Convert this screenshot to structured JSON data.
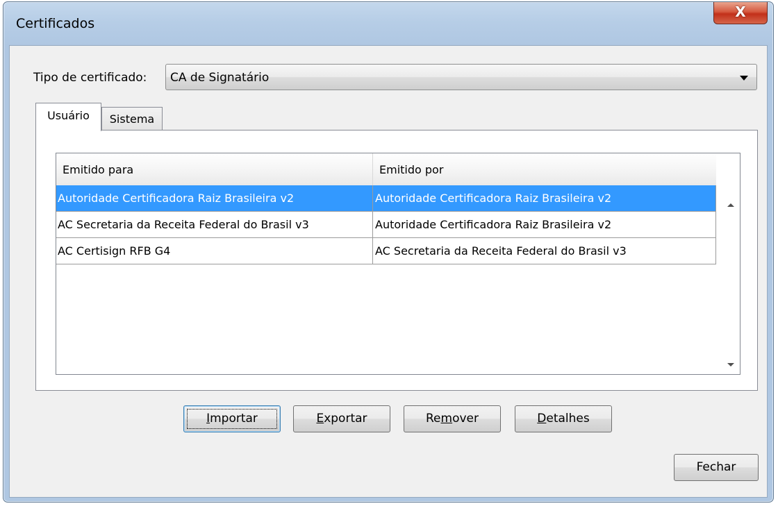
{
  "window": {
    "title": "Certificados",
    "close_glyph": "X"
  },
  "certificate_type": {
    "label": "Tipo de certificado:",
    "value": "CA de Signatário"
  },
  "tabs": [
    {
      "label": "Usuário",
      "active": true
    },
    {
      "label": "Sistema",
      "active": false
    }
  ],
  "table": {
    "columns": [
      "Emitido para",
      "Emitido por"
    ],
    "rows": [
      {
        "issued_to": "Autoridade Certificadora Raiz Brasileira v2",
        "issued_by": "Autoridade Certificadora Raiz Brasileira v2",
        "selected": true
      },
      {
        "issued_to": "AC Secretaria da Receita Federal do Brasil v3",
        "issued_by": "Autoridade Certificadora Raiz Brasileira v2",
        "selected": false
      },
      {
        "issued_to": "AC Certisign RFB G4",
        "issued_by": "AC Secretaria da Receita Federal do Brasil v3",
        "selected": false
      }
    ]
  },
  "buttons": {
    "import": {
      "mnemonic": "I",
      "rest": "mportar"
    },
    "export": {
      "mnemonic": "E",
      "rest": "xportar"
    },
    "remove": {
      "pre": "Re",
      "mnemonic": "m",
      "rest": "over"
    },
    "details": {
      "mnemonic": "D",
      "rest": "etalhes"
    },
    "close": {
      "label": "Fechar"
    }
  },
  "colors": {
    "selection": "#3399ff",
    "selection_text": "#ffffff",
    "window_frame": "#b6cde6",
    "close_button": "#c2301a"
  },
  "icons": {
    "close": "close-icon",
    "dropdown": "chevron-down-icon",
    "scroll_up": "scroll-up-arrow-icon",
    "scroll_down": "scroll-down-arrow-icon"
  }
}
